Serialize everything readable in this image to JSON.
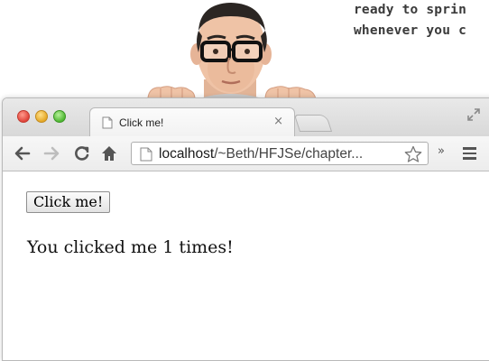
{
  "annotation": {
    "line1": "ready to sprin",
    "line2": "whenever you c"
  },
  "browser": {
    "tab": {
      "title": "Click me!",
      "close_glyph": "×"
    },
    "nav": {
      "back": "←",
      "forward": "→",
      "reload": "C",
      "home": "⌂"
    },
    "address": {
      "host": "localhost",
      "path": "/~Beth/HFJSe/chapter..."
    },
    "overflow_glyph": "»",
    "icons": [
      "page-icon",
      "close-icon",
      "fullscreen-icon",
      "back-arrow-icon",
      "forward-arrow-icon",
      "reload-icon",
      "home-icon",
      "star-icon",
      "overflow-icon",
      "menu-icon"
    ]
  },
  "page": {
    "button_label": "Click me!",
    "result_text": "You clicked me 1 times!"
  }
}
